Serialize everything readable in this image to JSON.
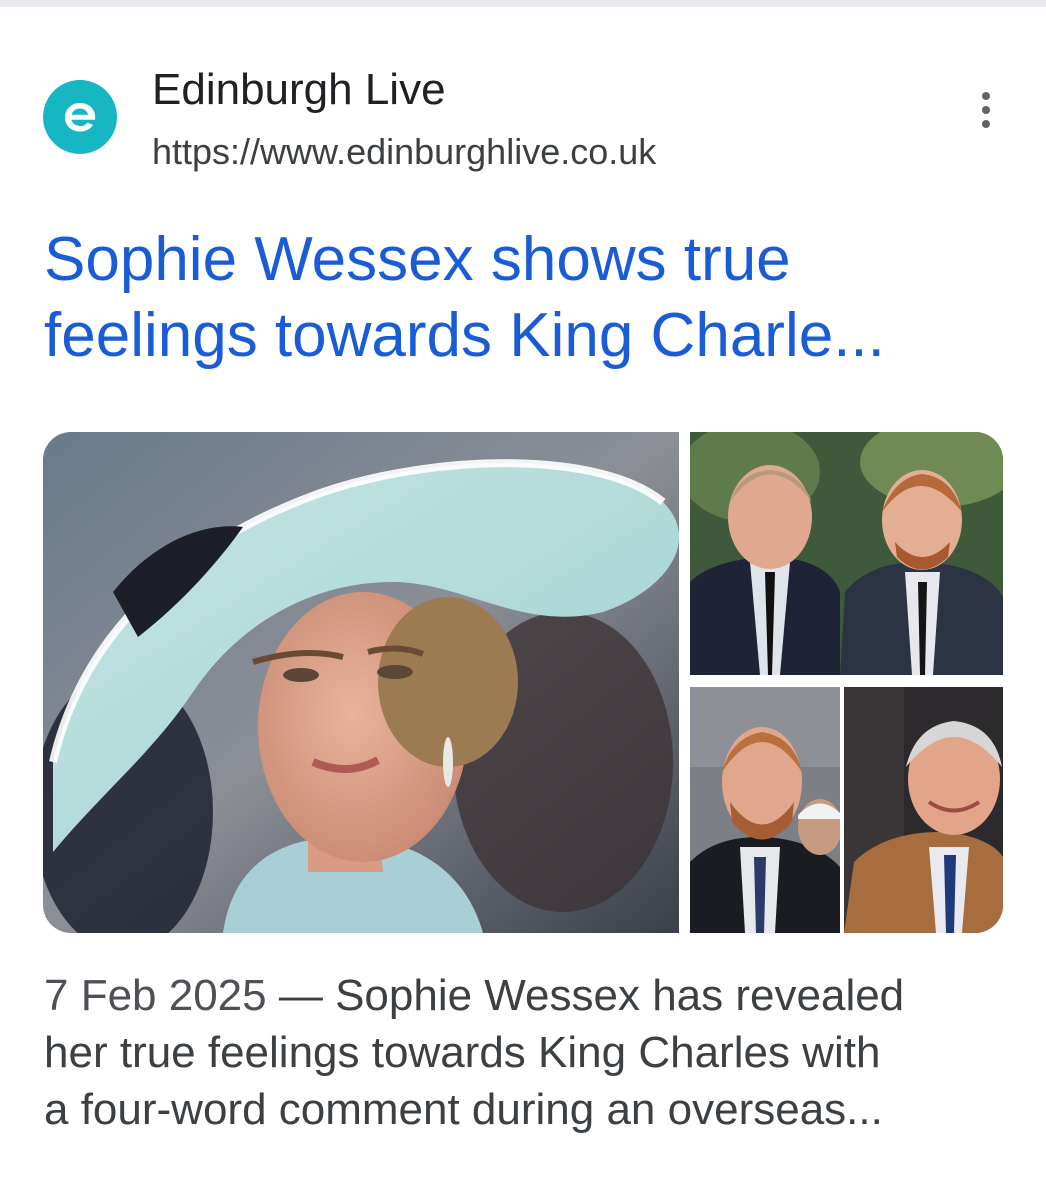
{
  "result": {
    "source": {
      "name": "Edinburgh Live",
      "url": "https://www.edinburghlive.co.uk",
      "favicon_letter": "e",
      "favicon_color": "#17b6c3",
      "menu_icon": "more-vert-icon"
    },
    "title_lines": [
      "Sophie Wessex shows true",
      "feelings towards King Charle..."
    ],
    "title_color": "#1a5cd6",
    "images": [
      {
        "depicts": "woman-in-light-blue-hat-photo"
      },
      {
        "depicts": "two-men-in-suits-photo"
      },
      {
        "depicts": "bearded-man-in-suit-photo"
      },
      {
        "depicts": "older-man-in-camel-coat-photo"
      }
    ],
    "snippet": {
      "date": "7 Feb 2025",
      "separator": " — ",
      "line1_rest": "Sophie Wessex has revealed",
      "line2": "her true feelings towards King Charles with",
      "line3": "a four-word comment during an overseas..."
    }
  }
}
